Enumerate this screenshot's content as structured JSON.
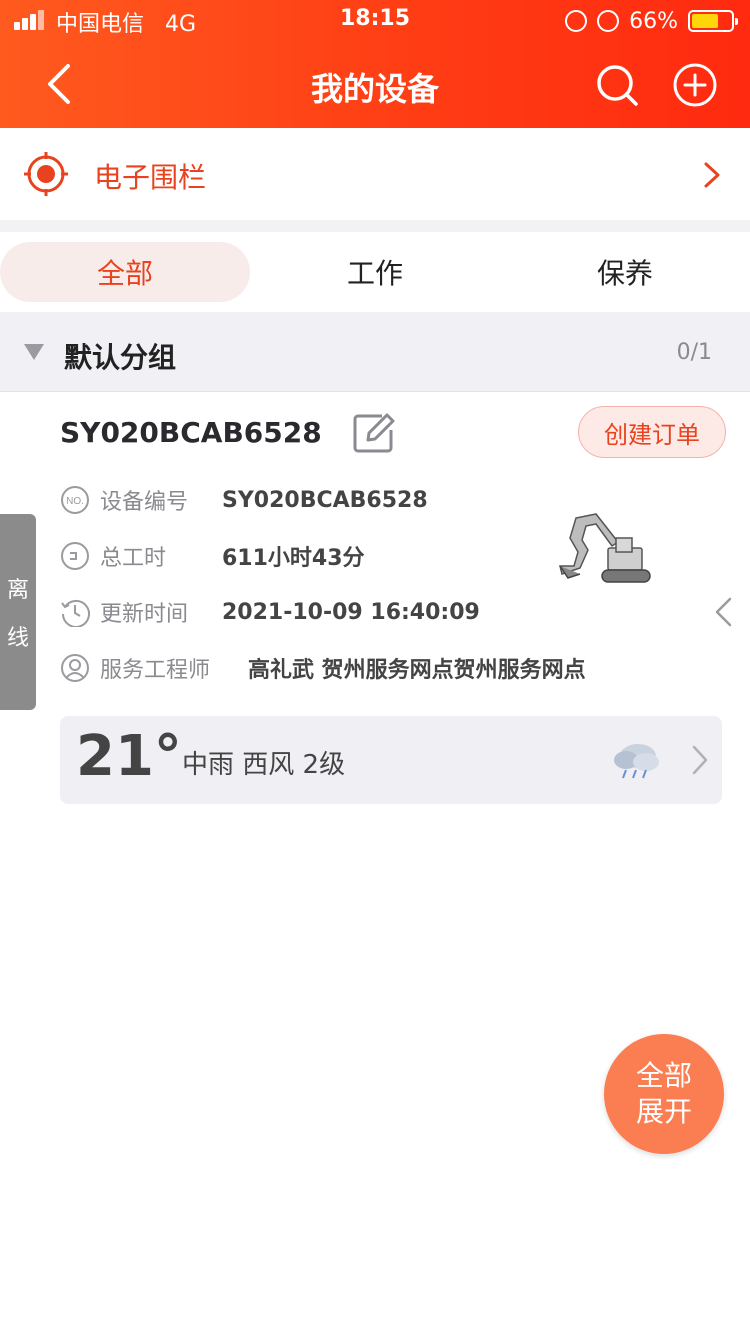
{
  "status_bar": {
    "carrier": "中国电信",
    "network": "4G",
    "time": "18:15",
    "battery": "66%"
  },
  "header": {
    "title": "我的设备",
    "icons": [
      "back-icon",
      "search-icon",
      "add-circle-icon"
    ]
  },
  "fence": {
    "label": "电子围栏",
    "icon": "target-icon"
  },
  "tabs": [
    {
      "label": "全部",
      "active": true
    },
    {
      "label": "工作",
      "active": false
    },
    {
      "label": "保养",
      "active": false
    }
  ],
  "group": {
    "label": "默认分组",
    "count": "0/1"
  },
  "device": {
    "id": "SY020BCAB6528",
    "order_button": "创建订单",
    "status_tag": [
      "离",
      "线"
    ],
    "rows": [
      {
        "icon": "no-icon",
        "label": "设备编号",
        "value": "SY020BCAB6528"
      },
      {
        "icon": "work-hours-icon",
        "label": "总工时",
        "value": "611小时43分"
      },
      {
        "icon": "clock-icon",
        "label": "更新时间",
        "value": "2021-10-09 16:40:09"
      },
      {
        "icon": "person-icon",
        "label": "服务工程师",
        "value": "高礼武  贺州服务网点贺州服务网点"
      }
    ]
  },
  "weather": {
    "temp": "21°",
    "desc": "中雨  西风  2级",
    "icon": "rain-cloud-icon"
  },
  "fab": {
    "line1": "全部",
    "line2": "展开"
  },
  "colors": {
    "accent": "#e8431e",
    "header_start": "#ff5a1f",
    "header_end": "#ff2a10",
    "fab": "#fb7d52"
  }
}
